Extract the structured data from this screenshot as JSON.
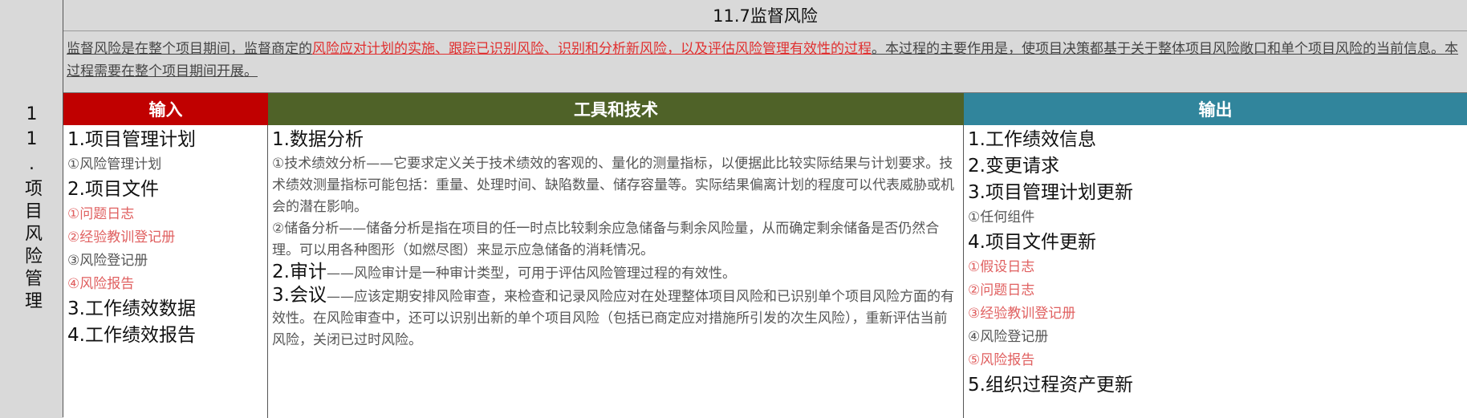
{
  "side_label": "11.项目风险管理",
  "title": "11.7监督风险",
  "description": {
    "part1": "监督风险是在整个项目期间，监督商定的",
    "part2_red": "风险应对计划的实施、跟踪已识别风险、识别和分析新风险，以及评估风险管理有效性的过程",
    "part3": "。本过程的主要作用是，使项目决策都基于关于整体项目风险敞口和单个项目风险的当前信息。本过程需要在整个项目期间开展。"
  },
  "headers": {
    "inputs": "输入",
    "tools": "工具和技术",
    "outputs": "输出"
  },
  "colors": {
    "inputs": "#c00000",
    "tools": "#4f6228",
    "outputs": "#31859c",
    "highlight": "#e03030"
  },
  "inputs": {
    "h1": "1.项目管理计划",
    "h1_s1": "①风险管理计划",
    "h2": "2.项目文件",
    "h2_s1": "①问题日志",
    "h2_s2": "②经验教训登记册",
    "h2_s3": "③风险登记册",
    "h2_s4": "④风险报告",
    "h3": "3.工作绩效数据",
    "h4": "4.工作绩效报告"
  },
  "tools": {
    "h1": "1.数据分析",
    "p1": "①技术绩效分析——它要求定义关于技术绩效的客观的、量化的测量指标，以便据此比较实际结果与计划要求。技术绩效测量指标可能包括：重量、处理时间、缺陷数量、储存容量等。实际结果偏离计划的程度可以代表威胁或机会的潜在影响。",
    "p2": "②储备分析——储备分析是指在项目的任一时点比较剩余应急储备与剩余风险量，从而确定剩余储备是否仍然合理。可以用各种图形（如燃尽图）来显示应急储备的消耗情况。",
    "h2": "2.审计",
    "p3": "——风险审计是一种审计类型，可用于评估风险管理过程的有效性。",
    "h3": "3.会议",
    "p4": "——应该定期安排风险审查，来检查和记录风险应对在处理整体项目风险和已识别单个项目风险方面的有效性。在风险审查中，还可以识别出新的单个项目风险（包括已商定应对措施所引发的次生风险），重新评估当前风险，关闭已过时风险。"
  },
  "outputs": {
    "h1": "1.工作绩效信息",
    "h2": "2.变更请求",
    "h3": "3.项目管理计划更新",
    "h3_s1": "①任何组件",
    "h4": "4.项目文件更新",
    "h4_s1": "①假设日志",
    "h4_s2": "②问题日志",
    "h4_s3": "③经验教训登记册",
    "h4_s4": "④风险登记册",
    "h4_s5": "⑤风险报告",
    "h5": "5.组织过程资产更新"
  }
}
